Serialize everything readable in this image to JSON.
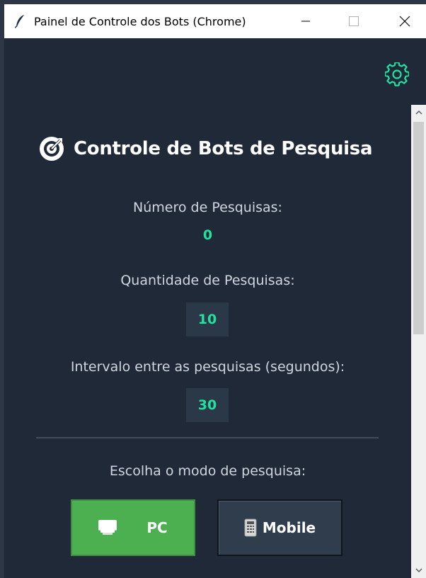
{
  "window": {
    "title": "Painel de Controle dos Bots (Chrome)"
  },
  "header": {
    "title": "Controle de Bots de Pesquisa",
    "icon": "target-icon",
    "settings_icon": "gear-icon"
  },
  "stats": {
    "searches_label": "Número de Pesquisas:",
    "searches_value": "0",
    "quantity_label": "Quantidade de Pesquisas:",
    "quantity_value": "10",
    "interval_label": "Intervalo entre as pesquisas (segundos):",
    "interval_value": "30"
  },
  "mode": {
    "label": "Escolha o modo de pesquisa:",
    "pc_label": "PC",
    "pc_icon": "monitor-icon",
    "mobile_label": "Mobile",
    "mobile_icon": "phone-icon"
  },
  "colors": {
    "background": "#1f2937",
    "accent": "#21e3a0",
    "pc_button": "#4caf50",
    "mobile_button": "#2f3d4d"
  }
}
